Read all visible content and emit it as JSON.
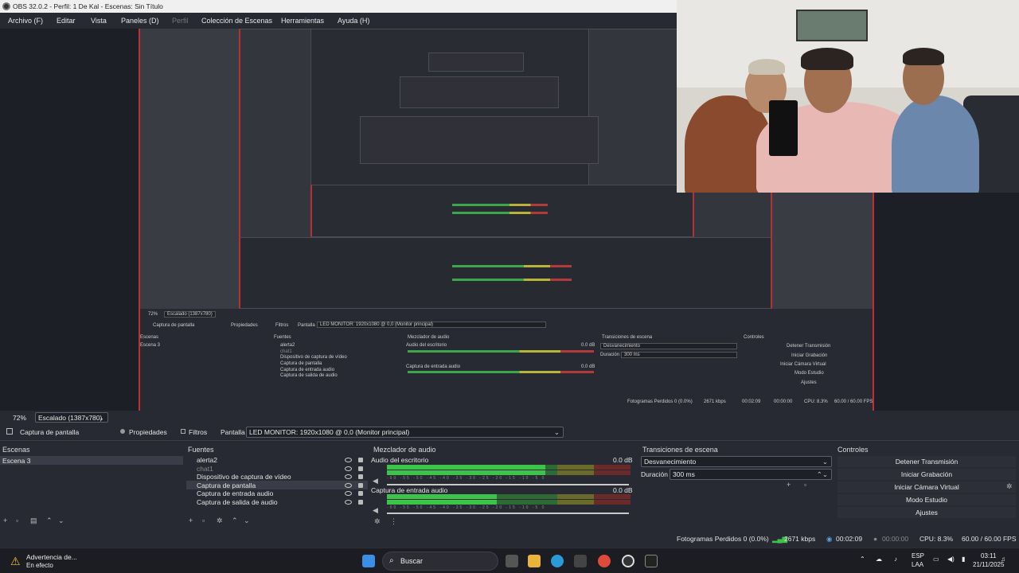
{
  "window": {
    "title": "OBS 32.0.2 - Perfil: 1 De Kal - Escenas: Sin Título"
  },
  "menu": [
    "Archivo (F)",
    "Editar",
    "Vista",
    "Paneles (D)",
    "Perfil",
    "Colección de Escenas",
    "Herramientas",
    "Ayuda (H)"
  ],
  "preview": {
    "zoom": "72%",
    "scale_select": "Escalado (1387x780)"
  },
  "source_bar": {
    "source": "Captura de pantalla",
    "properties": "Propiedades",
    "filters": "Filtros",
    "display_label": "Pantalla",
    "display_value": "LED MONITOR: 1920x1080 @ 0,0 (Monitor principal)"
  },
  "scenes": {
    "title": "Escenas",
    "items": [
      "Escena 3"
    ]
  },
  "sources": {
    "title": "Fuentes",
    "items": [
      "alerta2",
      "chat1",
      "Dispositivo de captura de vídeo",
      "Captura de pantalla",
      "Captura de entrada audio",
      "Captura de salida de audio"
    ]
  },
  "mixer": {
    "title": "Mezclador de audio",
    "channels": [
      {
        "name": "Audio del escritorio",
        "db": "0.0 dB",
        "level": 0.65
      },
      {
        "name": "Captura de entrada audio",
        "db": "0.0 dB",
        "level": 0.45
      }
    ],
    "ticks": "-60 -55 -50 -45 -40 -35 -30 -25 -20 -15 -10 -5 0"
  },
  "transitions": {
    "title": "Transiciones de escena",
    "type": "Desvanecimiento",
    "duration_label": "Duración",
    "duration_value": "300 ms"
  },
  "controls": {
    "title": "Controles",
    "buttons": [
      "Detener Transmisión",
      "Iniciar Grabación",
      "Iniciar Cámara Virtual",
      "Modo Estudio",
      "Ajustes"
    ]
  },
  "stats": {
    "dropped": "Fotogramas Perdidos 0 (0.0%)",
    "kbps": "2671 kbps",
    "stream_time": "00:02:09",
    "rec_time": "00:00:00",
    "cpu": "CPU: 8.3%",
    "fps": "60.00 / 60.00 FPS"
  },
  "taskbar": {
    "notif_title": "Advertencia de...",
    "notif_sub": "En efecto",
    "search": "Buscar",
    "lang1": "ESP",
    "lang2": "LAA",
    "time": "03:11",
    "date": "21/11/2025"
  },
  "colors": {
    "accent_red": "#c0303a",
    "meter_green": "#3cc34a"
  }
}
